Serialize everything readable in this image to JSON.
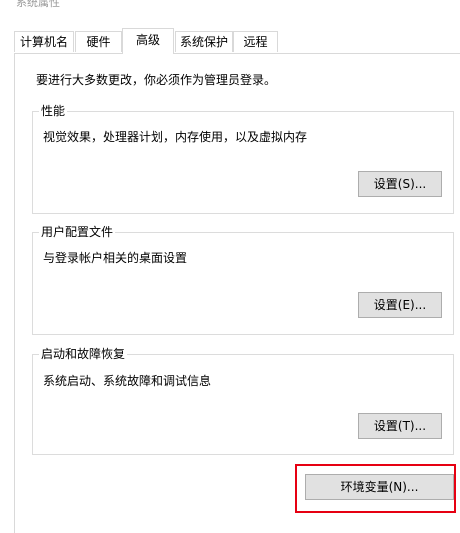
{
  "window": {
    "title": "系统属性"
  },
  "tabs": [
    {
      "label": "计算机名"
    },
    {
      "label": "硬件"
    },
    {
      "label": "高级"
    },
    {
      "label": "系统保护"
    },
    {
      "label": "远程"
    }
  ],
  "active_tab": "高级",
  "notice": "要进行大多数更改，你必须作为管理员登录。",
  "groups": {
    "performance": {
      "title": "性能",
      "description": "视觉效果，处理器计划，内存使用，以及虚拟内存",
      "button": "设置(S)..."
    },
    "user_profiles": {
      "title": "用户配置文件",
      "description": "与登录帐户相关的桌面设置",
      "button": "设置(E)..."
    },
    "startup_recovery": {
      "title": "启动和故障恢复",
      "description": "系统启动、系统故障和调试信息",
      "button": "设置(T)..."
    }
  },
  "env_button": "环境变量(N)...",
  "colors": {
    "highlight": "#e60012",
    "button_bg": "#e1e1e1",
    "border": "#d9d9d9"
  }
}
